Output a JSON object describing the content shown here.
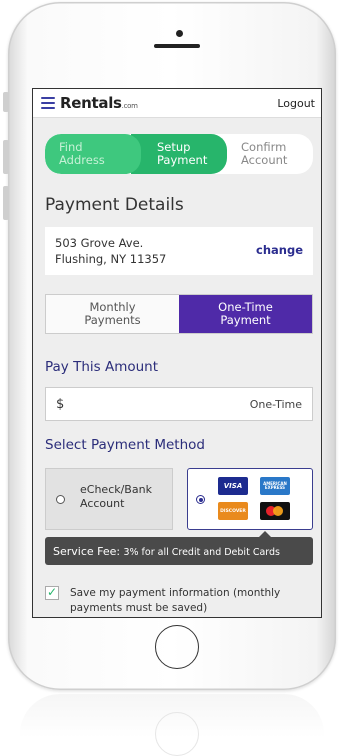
{
  "navbar": {
    "logo": "Rentals",
    "logo_suffix": ".com",
    "logout": "Logout"
  },
  "steps": [
    {
      "line1": "Find",
      "line2": "Address",
      "state": "done"
    },
    {
      "line1": "Setup",
      "line2": "Payment",
      "state": "active"
    },
    {
      "line1": "Confirm",
      "line2": "Account",
      "state": "pending"
    }
  ],
  "page_title": "Payment Details",
  "address": {
    "line1": "503 Grove Ave.",
    "line2": "Flushing, NY 11357",
    "change_label": "change"
  },
  "payment_frequency": {
    "options": [
      {
        "line1": "Monthly",
        "line2": "Payments",
        "selected": false
      },
      {
        "line1": "One-Time",
        "line2": "Payment",
        "selected": true
      }
    ]
  },
  "amount": {
    "heading": "Pay This Amount",
    "currency": "$",
    "type": "One-Time"
  },
  "method": {
    "heading": "Select Payment Method",
    "echeck_line1": "eCheck/Bank",
    "echeck_line2": "Account",
    "cards": {
      "visa": "VISA",
      "amex": "AMERICAN EXPRESS",
      "discover": "DISCOVER"
    },
    "selected": "card"
  },
  "service_fee": {
    "label": "Service Fee:",
    "text": "3% for all Credit and Debit Cards"
  },
  "save_info": {
    "checked": true,
    "text": "Save my payment information (monthly payments must be saved)"
  },
  "colors": {
    "accent": "#27b56b",
    "primary": "#4f2aa8",
    "heading": "#2b2d7a"
  }
}
